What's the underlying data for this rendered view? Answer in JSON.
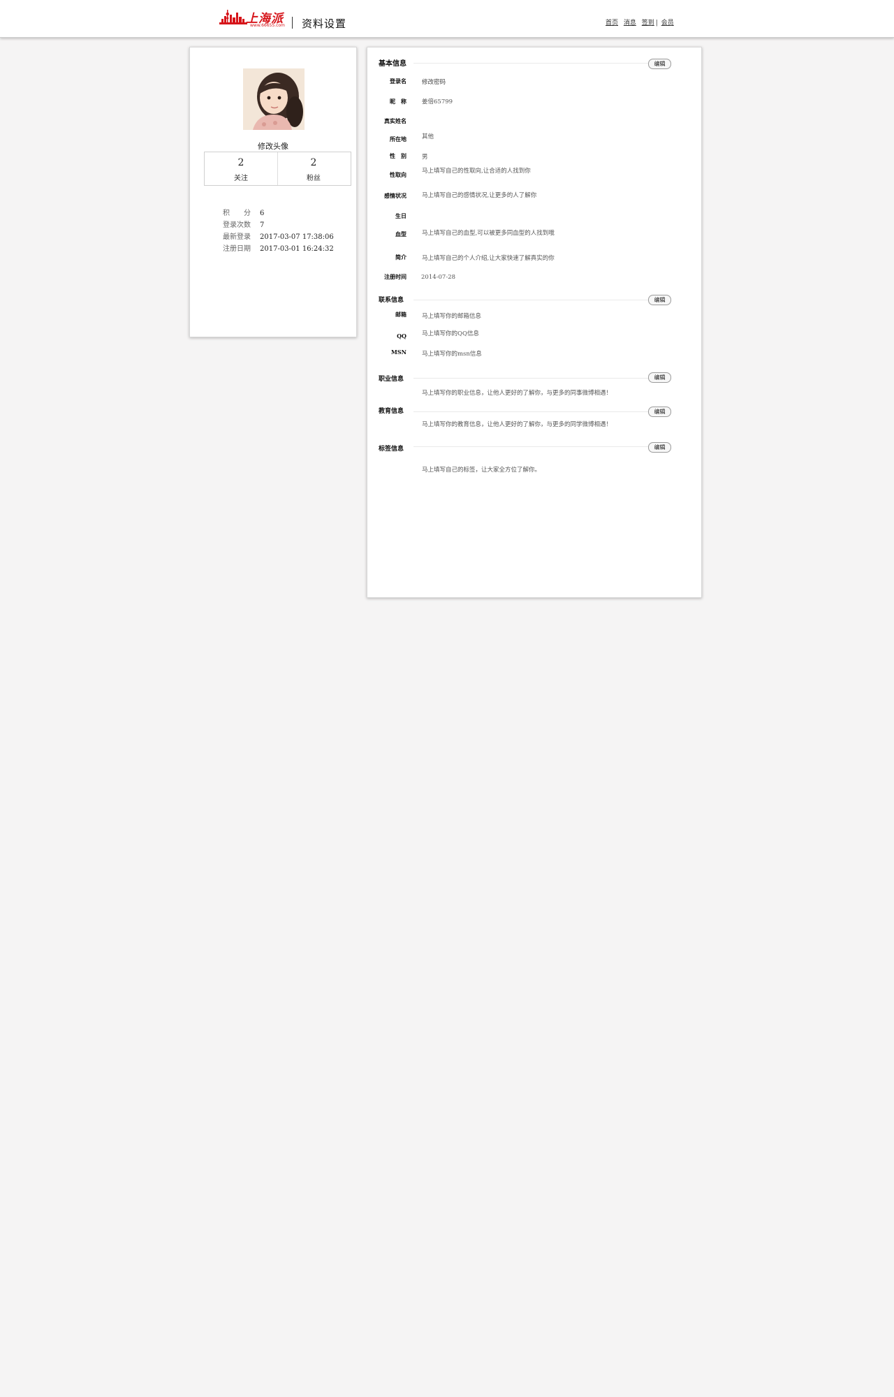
{
  "header": {
    "logo_text": "上海派",
    "logo_url": "www.66655.com",
    "page_title": "资料设置",
    "nav": [
      "首页",
      "消息",
      "签到",
      "会员"
    ]
  },
  "colors": {
    "brand_red": "#d6141a",
    "page_bg": "#f5f4f4"
  },
  "profile": {
    "change_avatar_label": "修改头像",
    "stats": [
      {
        "count": "2",
        "label": "关注"
      },
      {
        "count": "2",
        "label": "粉丝"
      }
    ],
    "meta": [
      {
        "label": "积　　分",
        "value": "6"
      },
      {
        "label": "登录次数",
        "value": "7"
      },
      {
        "label": "最新登录",
        "value": "2017-03-07 17:38:06"
      },
      {
        "label": "注册日期",
        "value": "2017-03-01 16:24:32"
      }
    ]
  },
  "edit_label": "编辑",
  "basic": {
    "title": "基本信息",
    "fields": [
      {
        "label": "登录名",
        "value": "修改密码"
      },
      {
        "label": "昵　称",
        "value": "姜倍65799"
      },
      {
        "label": "真实姓名",
        "value": ""
      },
      {
        "label": "所在地",
        "value": "其他"
      },
      {
        "label": "性　别",
        "value": "男"
      },
      {
        "label": "性取向",
        "value": "马上填写自己的性取向,让合适的人找到你"
      },
      {
        "label": "感情状况",
        "value": "马上填写自己的感情状况,让更多的人了解你"
      },
      {
        "label": "生日",
        "value": ""
      },
      {
        "label": "血型",
        "value": "马上填写自己的血型,可以被更多同血型的人找到哦"
      },
      {
        "label": "简介",
        "value": "马上填写自己的个人介绍,让大家快速了解真实的你"
      },
      {
        "label": "注册时间",
        "value": "2014-07-28"
      }
    ]
  },
  "contact": {
    "title": "联系信息",
    "fields": [
      {
        "label": "邮箱",
        "value": "马上填写你的邮箱信息"
      },
      {
        "label": "QQ",
        "value": "马上填写你的QQ信息"
      },
      {
        "label": "MSN",
        "value": "马上填写你的msn信息"
      }
    ]
  },
  "career": {
    "title": "职业信息",
    "text": "马上填写你的职业信息，让他人更好的了解你，与更多的同事微博相遇！"
  },
  "education": {
    "title": "教育信息",
    "text": "马上填写你的教育信息，让他人更好的了解你，与更多的同学微博相遇！"
  },
  "tags": {
    "title": "标签信息",
    "text": "马上填写自己的标签，让大家全方位了解你。"
  }
}
